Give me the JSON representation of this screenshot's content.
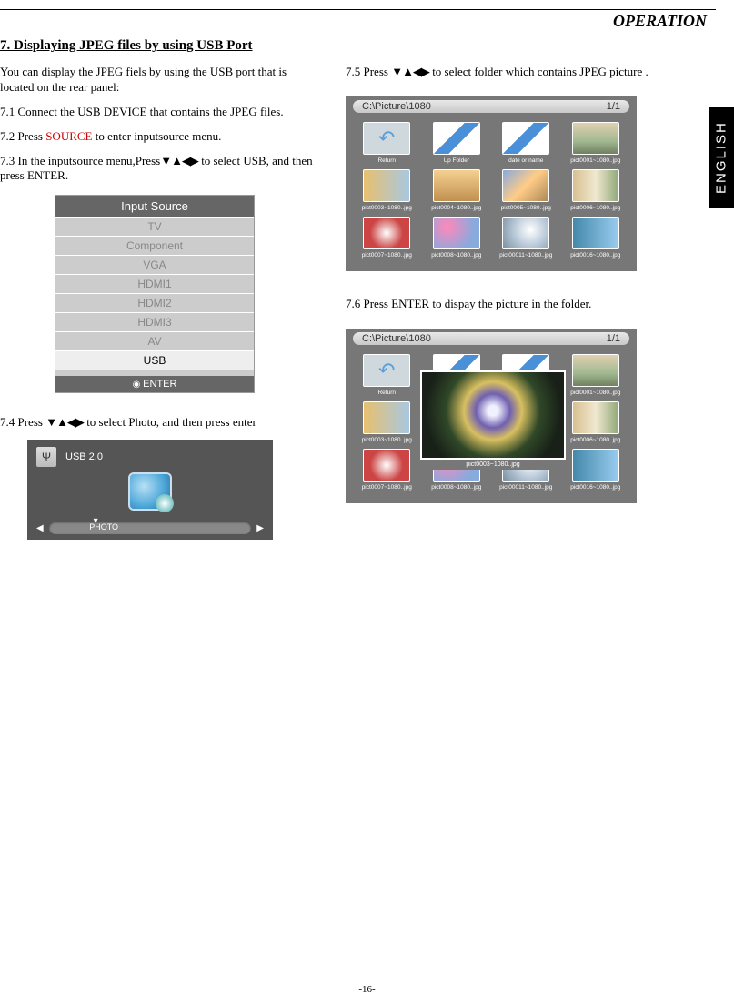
{
  "header": {
    "operation": "OPERATION",
    "lang_tab": "ENGLISH"
  },
  "section": {
    "heading": "7.  Displaying JPEG files by using USB Port"
  },
  "intro": "You can display the JPEG fiels by using the USB port that is located on the rear panel:",
  "steps": {
    "s71": "7.1  Connect the USB DEVICE that contains the JPEG files.",
    "s72a": "7.2  Press ",
    "s72_src": "SOURCE",
    "s72b": " to enter inputsource menu.",
    "s73a": "7.3  In the inputsource menu,Press",
    "s73b": " to select USB, and then press ENTER.",
    "s74a": "7.4 Press ",
    "s74b": "to select Photo, and then press enter",
    "s75a": "7.5  Press ",
    "s75b": "to select folder which contains  JPEG picture .",
    "s76": "7.6  Press ENTER to dispay the picture in the folder."
  },
  "arrows4": "▼▲◀▶",
  "input_source": {
    "title": "Input Source",
    "items": [
      "TV",
      "Component",
      "VGA",
      "HDMI1",
      "HDMI2",
      "HDMI3",
      "AV",
      "USB"
    ],
    "footer": "ENTER"
  },
  "usb_panel": {
    "label": "USB 2.0",
    "slider_label": "PHOTO"
  },
  "browser": {
    "path": "C:\\Picture\\1080",
    "page": "1/1",
    "row1": [
      "Return",
      "Up Folder",
      "date or name",
      "pict0001~1080..jpg"
    ],
    "row2": [
      "pict0003~1080..jpg",
      "pict0004~1080..jpg",
      "pict0005~1080..jpg",
      "pict0006~1080..jpg"
    ],
    "row3": [
      "pict0007~1080..jpg",
      "pict0008~1080..jpg",
      "pict00011~1080..jpg",
      "pict0016~1080..jpg"
    ]
  },
  "browser2": {
    "path": "C:\\Picture\\1080",
    "page": "1/1",
    "row1": [
      "Return",
      "",
      "",
      "pict0001~1080..jpg"
    ],
    "row2": [
      "pict0003~1080..jpg",
      "",
      "",
      "pict0006~1080..jpg"
    ],
    "row3": [
      "pict0007~1080..jpg",
      "pict0008~1080..jpg",
      "pict00011~1080..jpg",
      "pict0016~1080..jpg"
    ],
    "preview_caption": "pict0003~1080..jpg"
  },
  "page_number": "-16-"
}
